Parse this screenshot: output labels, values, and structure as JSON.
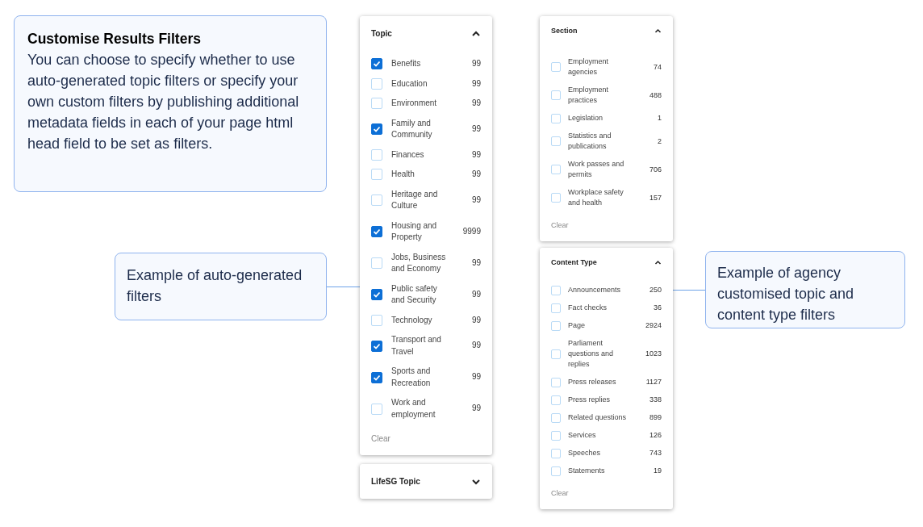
{
  "callouts": [
    {
      "title": "Customise Results Filters",
      "body": "You can choose to specify whether to use auto-generated topic filters or specify your own custom filters by publishing additional metadata fields in each of your page html head field to be set as filters."
    },
    {
      "body": "Example of auto-generated filters"
    },
    {
      "body": "Example of agency customised topic and content type filters"
    }
  ],
  "filter_panels": [
    {
      "title": "Topic",
      "expanded": true,
      "clear": "Clear",
      "options": [
        {
          "label": "Benefits",
          "count": "99",
          "checked": true
        },
        {
          "label": "Education",
          "count": "99",
          "checked": false
        },
        {
          "label": "Environment",
          "count": "99",
          "checked": false
        },
        {
          "label": "Family and Community",
          "count": "99",
          "checked": true
        },
        {
          "label": "Finances",
          "count": "99",
          "checked": false
        },
        {
          "label": "Health",
          "count": "99",
          "checked": false
        },
        {
          "label": "Heritage and Culture",
          "count": "99",
          "checked": false
        },
        {
          "label": "Housing and Property",
          "count": "9999",
          "checked": true
        },
        {
          "label": "Jobs, Business and Economy",
          "count": "99",
          "checked": false
        },
        {
          "label": "Public safety and Security",
          "count": "99",
          "checked": true
        },
        {
          "label": "Technology",
          "count": "99",
          "checked": false
        },
        {
          "label": "Transport and Travel",
          "count": "99",
          "checked": true
        },
        {
          "label": "Sports and Recreation",
          "count": "99",
          "checked": true
        },
        {
          "label": "Work and employment",
          "count": "99",
          "checked": false
        }
      ]
    },
    {
      "title": "LifeSG Topic",
      "expanded": false
    },
    {
      "title": "Section",
      "expanded": true,
      "clear": "Clear",
      "options": [
        {
          "label": "Employment agencies",
          "count": "74",
          "checked": false
        },
        {
          "label": "Employment practices",
          "count": "488",
          "checked": false
        },
        {
          "label": "Legislation",
          "count": "1",
          "checked": false
        },
        {
          "label": "Statistics and publications",
          "count": "2",
          "checked": false
        },
        {
          "label": "Work passes and permits",
          "count": "706",
          "checked": false
        },
        {
          "label": "Workplace safety and health",
          "count": "157",
          "checked": false
        }
      ]
    },
    {
      "title": "Content Type",
      "expanded": true,
      "clear": "Clear",
      "options": [
        {
          "label": "Announcements",
          "count": "250",
          "checked": false
        },
        {
          "label": "Fact checks",
          "count": "36",
          "checked": false
        },
        {
          "label": "Page",
          "count": "2924",
          "checked": false
        },
        {
          "label": "Parliament questions and replies",
          "count": "1023",
          "checked": false
        },
        {
          "label": "Press releases",
          "count": "1127",
          "checked": false
        },
        {
          "label": "Press replies",
          "count": "338",
          "checked": false
        },
        {
          "label": "Related questions",
          "count": "899",
          "checked": false
        },
        {
          "label": "Services",
          "count": "126",
          "checked": false
        },
        {
          "label": "Speeches",
          "count": "743",
          "checked": false
        },
        {
          "label": "Statements",
          "count": "19",
          "checked": false
        }
      ]
    }
  ]
}
